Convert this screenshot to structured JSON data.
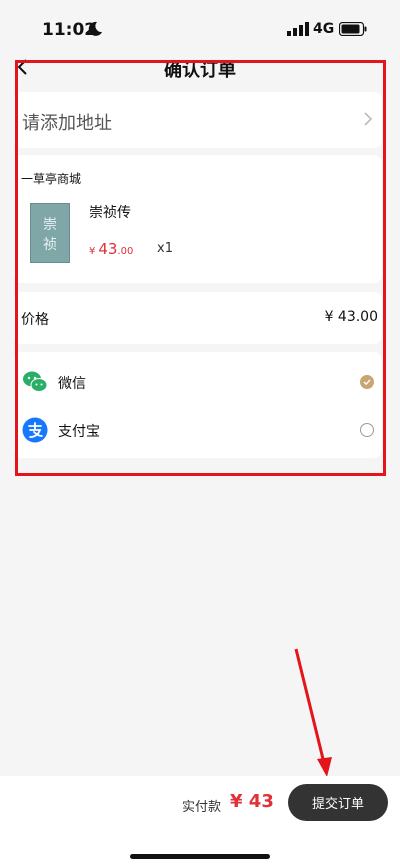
{
  "status": {
    "time": "11:02",
    "network": "4G"
  },
  "nav": {
    "title": "确认订单"
  },
  "address": {
    "placeholder": "请添加地址"
  },
  "order": {
    "shop": "一草亭商城",
    "book_cover_chars": [
      "崇",
      "祯"
    ],
    "item_title": "崇祯传",
    "price_symbol": "¥",
    "price_int": "43",
    "price_dec": ".00",
    "quantity": "x1"
  },
  "price_line": {
    "label": "价格",
    "value": "¥ 43.00"
  },
  "payment": {
    "options": [
      {
        "label": "微信",
        "icon": "wechat-icon",
        "selected": true
      },
      {
        "label": "支付宝",
        "icon": "alipay-icon",
        "selected": false
      }
    ]
  },
  "footer": {
    "pay_label": "实付款",
    "total": "¥ 43",
    "submit_label": "提交订单"
  },
  "colors": {
    "accent_red": "#e0313a",
    "annotation_red": "#e3141c",
    "button_dark": "#333333",
    "radio_selected": "#c9a574"
  }
}
